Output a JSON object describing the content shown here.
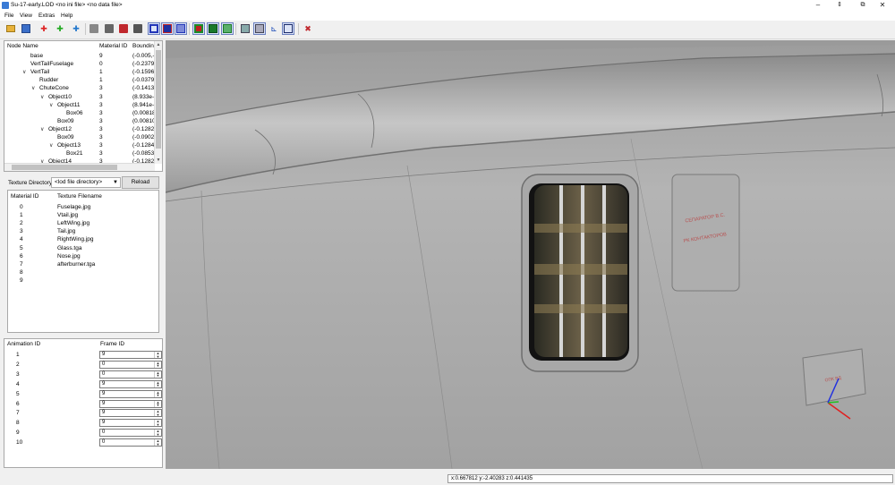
{
  "window": {
    "title": "Su-17-early.LOD  <no ini file>  <no data file>",
    "minimize": "–",
    "pin": "⇕",
    "maximize": "⧉",
    "close": "✕"
  },
  "menu": [
    "File",
    "View",
    "Extras",
    "Help"
  ],
  "toolbar": {
    "icons": [
      "open-folder",
      "save-disk",
      "plus-red",
      "plus-green",
      "plus-blue",
      "grey-box",
      "grey-box-2",
      "red-box",
      "grey-box-3",
      "blue-cube-outline",
      "blue-cube-solid",
      "blue-cube-wire",
      "green-cube-outline",
      "green-cube-solid",
      "green-cube-wire",
      "grey-layers",
      "grey-layers-2",
      "axes",
      "cube-outline",
      "tools-cross"
    ]
  },
  "node_tree": {
    "headers": [
      "Node Name",
      "Material ID",
      "Boundin"
    ],
    "rows": [
      {
        "name": "base",
        "indent": 0,
        "expand": "",
        "mat": "9",
        "bound": "(-0.005,-7"
      },
      {
        "name": "VertTailFuselage",
        "indent": 1,
        "expand": "",
        "mat": "0",
        "bound": "(-0.2379,-"
      },
      {
        "name": "VertTail",
        "indent": 1,
        "expand": "∨",
        "mat": "1",
        "bound": "(-0.1596,-"
      },
      {
        "name": "Rudder",
        "indent": 2,
        "expand": "",
        "mat": "1",
        "bound": "(-0.03796,"
      },
      {
        "name": "ChuteCone",
        "indent": 2,
        "expand": "∨",
        "mat": "3",
        "bound": "(-0.1413,-"
      },
      {
        "name": "Object10",
        "indent": 3,
        "expand": "∨",
        "mat": "3",
        "bound": "(8.933e-0"
      },
      {
        "name": "Object11",
        "indent": 4,
        "expand": "∨",
        "mat": "3",
        "bound": "(8.941e-0"
      },
      {
        "name": "Box06",
        "indent": 5,
        "expand": "",
        "mat": "3",
        "bound": "(0.008183"
      },
      {
        "name": "Box09",
        "indent": 4,
        "expand": "",
        "mat": "3",
        "bound": "(0.008109"
      },
      {
        "name": "Object12",
        "indent": 3,
        "expand": "∨",
        "mat": "3",
        "bound": "(-0.1282,-"
      },
      {
        "name": "Box09",
        "indent": 4,
        "expand": "",
        "mat": "3",
        "bound": "(-0.09023,"
      },
      {
        "name": "Object13",
        "indent": 4,
        "expand": "∨",
        "mat": "3",
        "bound": "(-0.1284,-"
      },
      {
        "name": "Box21",
        "indent": 5,
        "expand": "",
        "mat": "3",
        "bound": "(-0.08539,"
      },
      {
        "name": "Object14",
        "indent": 3,
        "expand": "∨",
        "mat": "3",
        "bound": "(-0.1282,-"
      }
    ]
  },
  "texture": {
    "directory_label": "Texture Directory:",
    "directory_value": "<lod file directory>",
    "reload_label": "Reload",
    "headers": [
      "Material ID",
      "Texture Filename"
    ],
    "rows": [
      {
        "id": "0",
        "file": "Fuselage.jpg"
      },
      {
        "id": "1",
        "file": "Vtail.jpg"
      },
      {
        "id": "2",
        "file": "LeftWing.jpg"
      },
      {
        "id": "3",
        "file": "Tail.jpg"
      },
      {
        "id": "4",
        "file": "RightWing.jpg"
      },
      {
        "id": "5",
        "file": "Glass.tga"
      },
      {
        "id": "6",
        "file": "Nose.jpg"
      },
      {
        "id": "7",
        "file": "afterburner.tga"
      },
      {
        "id": "8",
        "file": ""
      },
      {
        "id": "9",
        "file": ""
      }
    ]
  },
  "animation": {
    "headers": [
      "Animation ID",
      "Frame ID"
    ],
    "rows": [
      {
        "id": "1",
        "frame": "9"
      },
      {
        "id": "2",
        "frame": "0"
      },
      {
        "id": "3",
        "frame": "0"
      },
      {
        "id": "4",
        "frame": "9"
      },
      {
        "id": "5",
        "frame": "9"
      },
      {
        "id": "6",
        "frame": "9"
      },
      {
        "id": "7",
        "frame": "9"
      },
      {
        "id": "8",
        "frame": "9"
      },
      {
        "id": "9",
        "frame": "0"
      },
      {
        "id": "10",
        "frame": "0"
      }
    ]
  },
  "viewport": {
    "panel_text_1": "СЕПАРАТОР В.С.",
    "panel_text_2": "РК КОНТАКТОРОВ",
    "panel_text_3": "ОПК ВД"
  },
  "status": {
    "coords": "x:0.667812 y:-2.40283 z:0.441435"
  }
}
